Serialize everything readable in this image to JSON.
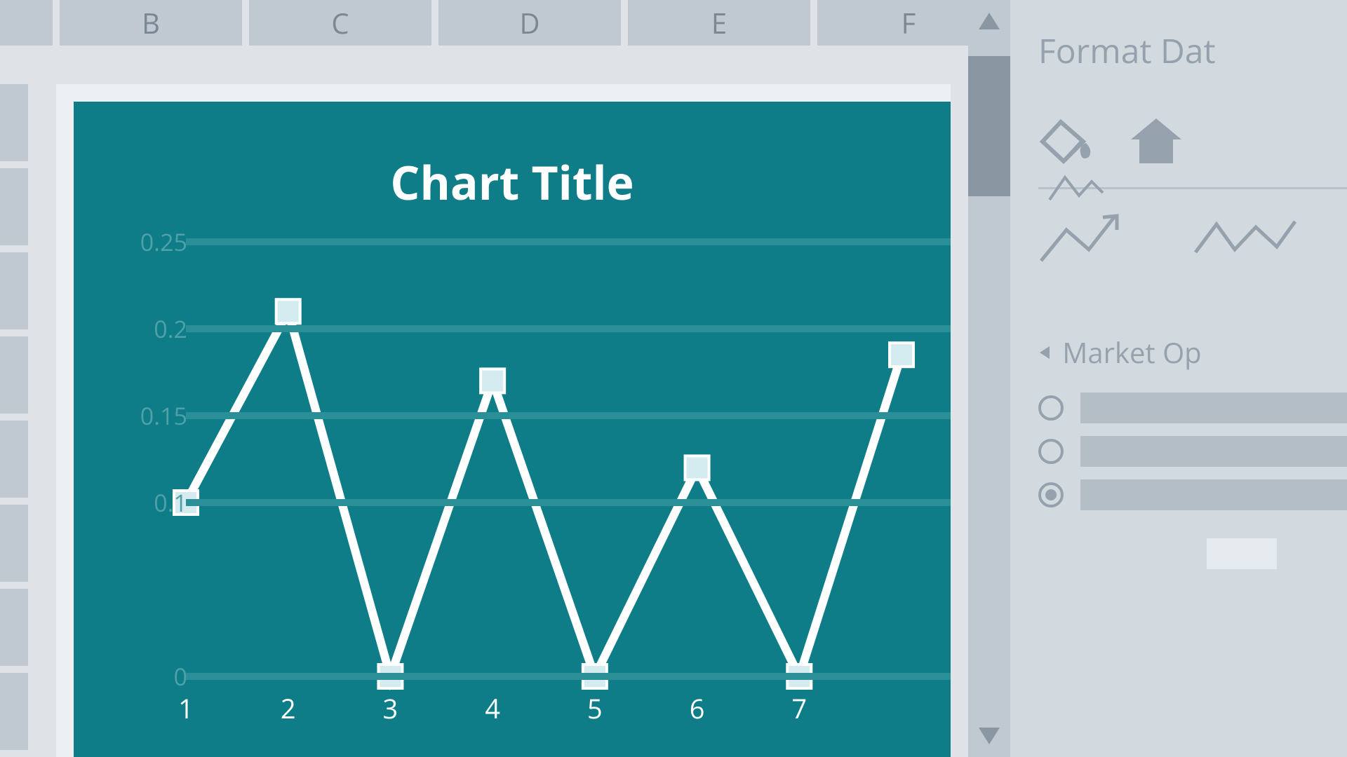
{
  "columns": [
    "B",
    "C",
    "D",
    "E",
    "F"
  ],
  "format_pane": {
    "title": "Format Dat",
    "section": "Market Op",
    "options": [
      {
        "selected": false
      },
      {
        "selected": false
      },
      {
        "selected": true
      }
    ]
  },
  "chart_data": {
    "type": "line",
    "title": "Chart Title",
    "xlabel": "",
    "ylabel": "",
    "ylim": [
      0,
      0.25
    ],
    "yticks": [
      0,
      0.1,
      0.15,
      0.2,
      0.25
    ],
    "categories": [
      "1",
      "2",
      "3",
      "4",
      "5",
      "6",
      "7"
    ],
    "values": [
      0.1,
      0.21,
      0.0,
      0.17,
      0.0,
      0.12,
      0.0,
      0.185
    ]
  },
  "colors": {
    "chartBg": "#0e7d88",
    "gridline": "#2a8f97",
    "marker": "#d4ecef",
    "line": "#ffffff",
    "paneBg": "#d2d9df",
    "paneText": "#95a2ae"
  }
}
